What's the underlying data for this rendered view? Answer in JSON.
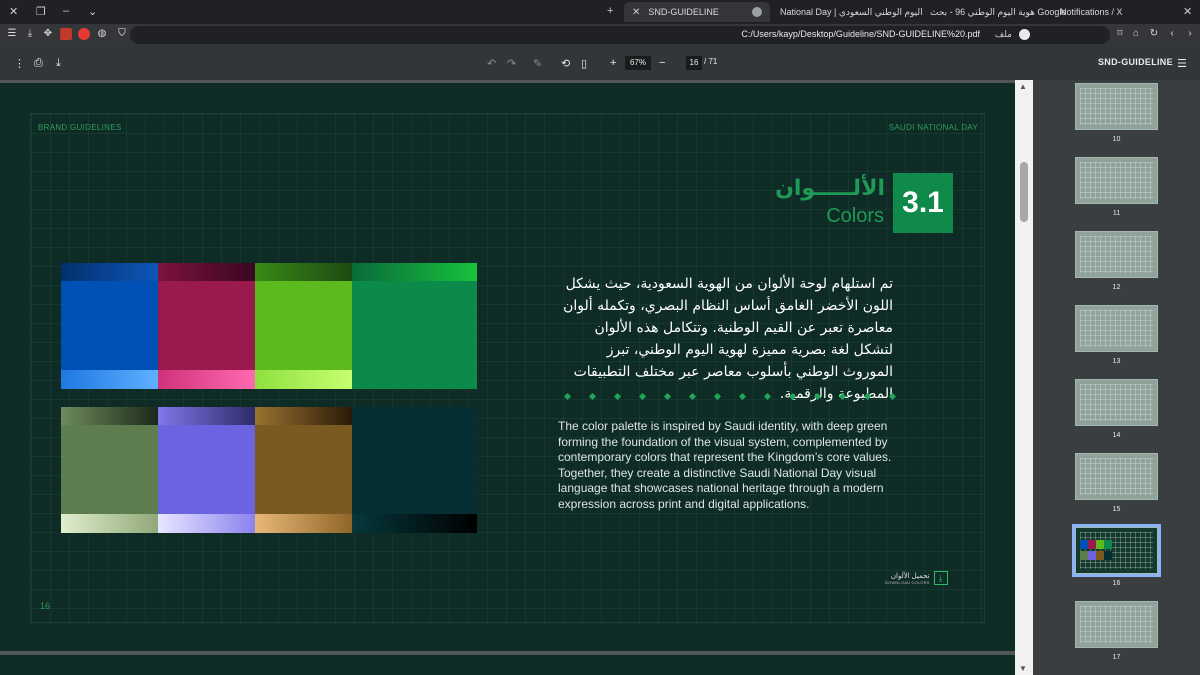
{
  "browser": {
    "tabs": [
      {
        "label": "SND-GUIDELINE",
        "active": true
      },
      {
        "label": "National Day | اليوم الوطني السعودي",
        "active": false
      },
      {
        "label": "هوية اليوم الوطني 96 - بحث Google",
        "active": false
      },
      {
        "label": "Notifications / X",
        "active": false
      }
    ],
    "new_tab": "+",
    "url": "C:/Users/kayp/Desktop/Guideline/SND-GUIDELINE%20.pdf",
    "url_label": "ملف"
  },
  "pdf_toolbar": {
    "zoom": "67%",
    "page_current": "16",
    "page_total": "/ 71",
    "title": "SND-GUIDELINE"
  },
  "page": {
    "header_left": "BRAND GUIDELINES",
    "header_right": "SAUDI NATIONAL DAY",
    "section_number": "3.1",
    "section_title_ar": "الألـــــوان",
    "section_title_en": "Colors",
    "body_ar": "تم استلهام لوحة الألوان من الهوية السعودية، حيث يشكل اللون الأخضر الغامق أساس النظام البصري، وتكمله ألوان معاصرة تعبر عن القيم الوطنية. وتتكامل هذه الألوان لتشكل لغة بصرية مميزة لهوية اليوم الوطني، تبرز الموروث الوطني بأسلوب معاصر عبر مختلف التطبيقات المطبوعة والرقمية.",
    "body_en": "The color palette is inspired by Saudi identity, with deep green forming the foundation of the visual system, complemented by contemporary colors that represent the Kingdom’s core values. Together, they create a distinctive Saudi National Day visual language that showcases national heritage through a modern expression across print and digital applications.",
    "download_ar": "تحميل الألوان",
    "download_en": "DOWNLOAD COLORS",
    "page_number": "16"
  },
  "palette": {
    "row1": [
      {
        "main": "#0050b5",
        "top": [
          "#02306e",
          "#0e56b8"
        ],
        "bottom": [
          "#1f78e0",
          "#5fb0ff"
        ]
      },
      {
        "main": "#9a1a4f",
        "top": [
          "#7d1240",
          "#3a0620"
        ],
        "bottom": [
          "#d0327a",
          "#ff6ab0"
        ]
      },
      {
        "main": "#5cba1f",
        "top": [
          "#3a8a16",
          "#1c4a12"
        ],
        "bottom": [
          "#8fe040",
          "#c6ff70"
        ]
      },
      {
        "main": "#0b8a4a",
        "top": [
          "#0a6a3a",
          "#16c23c"
        ],
        "bottom": [
          "#0b8a4a",
          "#0b8a4a"
        ]
      }
    ],
    "row2": [
      {
        "main": "#5e7d4e",
        "top": [
          "#6f8a5c",
          "#1a2a1a"
        ],
        "bottom": [
          "#dfeecd",
          "#90a878"
        ]
      },
      {
        "main": "#6c63e0",
        "top": [
          "#7f78e8",
          "#2f2a6a"
        ],
        "bottom": [
          "#e8e6ff",
          "#8a82ee"
        ]
      },
      {
        "main": "#7b5a22",
        "top": [
          "#9b7230",
          "#2a1a08"
        ],
        "bottom": [
          "#e8b878",
          "#8f6628"
        ]
      },
      {
        "main": "#052f33",
        "top": [
          "#052f33",
          "#052f33"
        ],
        "bottom": [
          "#06383c",
          "#000000"
        ]
      }
    ]
  },
  "sidebar": {
    "thumbnails": [
      {
        "label": "10",
        "selected": false
      },
      {
        "label": "11",
        "selected": false
      },
      {
        "label": "12",
        "selected": false
      },
      {
        "label": "13",
        "selected": false
      },
      {
        "label": "14",
        "selected": false
      },
      {
        "label": "15",
        "selected": false
      },
      {
        "label": "16",
        "selected": true
      },
      {
        "label": "17",
        "selected": false
      }
    ]
  }
}
